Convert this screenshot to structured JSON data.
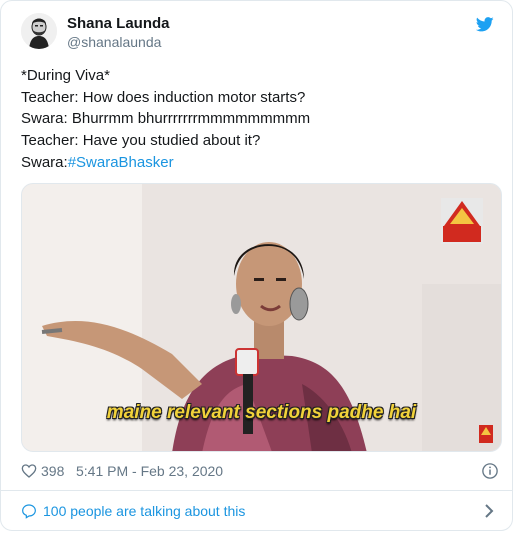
{
  "tweet": {
    "author_name": "Shana Launda",
    "author_handle": "@shanalaunda",
    "lines": [
      "*During Viva*",
      "Teacher: How does induction motor starts?",
      "Swara: Bhurrmm bhurrrrrrrmmmmmmmmm",
      "Teacher: Have you studied about it?"
    ],
    "last_line_prefix": "Swara:",
    "hashtag": "#SwaraBhasker",
    "media_caption": "maine relevant sections padhe hai",
    "likes": "398",
    "timestamp": "5:41 PM - Feb 23, 2020",
    "conversation": "100 people are talking about this"
  },
  "colors": {
    "link": "#1b95e0",
    "secondary": "#657786",
    "twitter_bird": "#1da1f2",
    "caption": "#f1d23a"
  },
  "icons": {
    "bird": "twitter-bird-icon",
    "heart": "heart-icon",
    "info": "info-icon",
    "bubble": "speech-bubble-icon",
    "chevron": "chevron-right-icon"
  }
}
